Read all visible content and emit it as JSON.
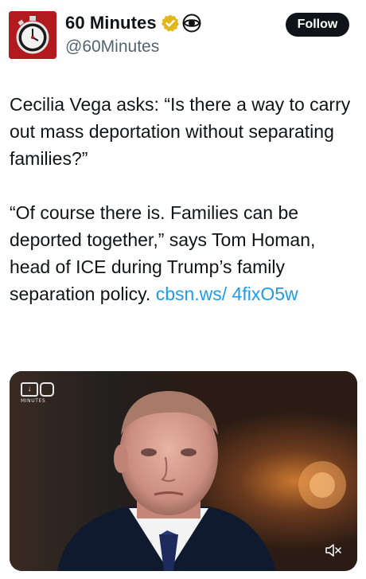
{
  "account": {
    "display_name": "60 Minutes",
    "handle": "@60Minutes",
    "verified_icon": "verified-badge-icon",
    "affiliate_icon": "cbs-eye-icon",
    "avatar_icon": "stopwatch-icon"
  },
  "follow_button": {
    "label": "Follow"
  },
  "tweet": {
    "paragraph1": "Cecilia Vega asks: “Is there a way to carry out mass deportation without separating families?”",
    "paragraph2_text": "“Of course there is. Families can be deported together,” says Tom Homan, head of ICE during Trump’s family separation policy. ",
    "link_text": "cbsn.ws/ 4fixO5w"
  },
  "media": {
    "watermark_text": "MINUTES",
    "mute_icon": "speaker-muted-icon"
  },
  "colors": {
    "text": "#0f1419",
    "secondary": "#536471",
    "link": "#1d9bf0",
    "brand_red": "#b11a1f",
    "verified_gold": "#e2b719"
  }
}
